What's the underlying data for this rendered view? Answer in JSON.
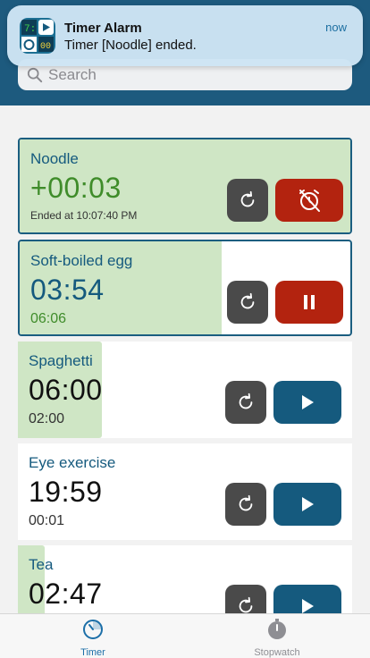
{
  "notification": {
    "app_name": "Timer Alarm",
    "message": "Timer [Noodle] ended.",
    "time": "now"
  },
  "search": {
    "placeholder": "Search"
  },
  "timers": [
    {
      "name": "Noodle",
      "display": "+00:03",
      "note": "Ended at 10:07:40 PM",
      "state": "ended",
      "progress": 1.0
    },
    {
      "name": "Soft-boiled egg",
      "display": "03:54",
      "note": "06:06",
      "state": "running",
      "progress": 0.61
    },
    {
      "name": "Spaghetti",
      "display": "06:00",
      "note": "02:00",
      "state": "idle",
      "progress": 0.25
    },
    {
      "name": "Eye exercise",
      "display": "19:59",
      "note": "00:01",
      "state": "idle",
      "progress": 0.0
    },
    {
      "name": "Tea",
      "display": "02:47",
      "note": "",
      "state": "idle",
      "progress": 0.08
    }
  ],
  "tabs": [
    {
      "label": "Timer",
      "icon": "timer-icon",
      "active": true
    },
    {
      "label": "Stopwatch",
      "icon": "stopwatch-icon",
      "active": false
    }
  ],
  "colors": {
    "accent": "#155a7e",
    "progress_fill": "#cfe6c5",
    "stop_red": "#b3230f",
    "ended_green": "#3f8c2a"
  }
}
